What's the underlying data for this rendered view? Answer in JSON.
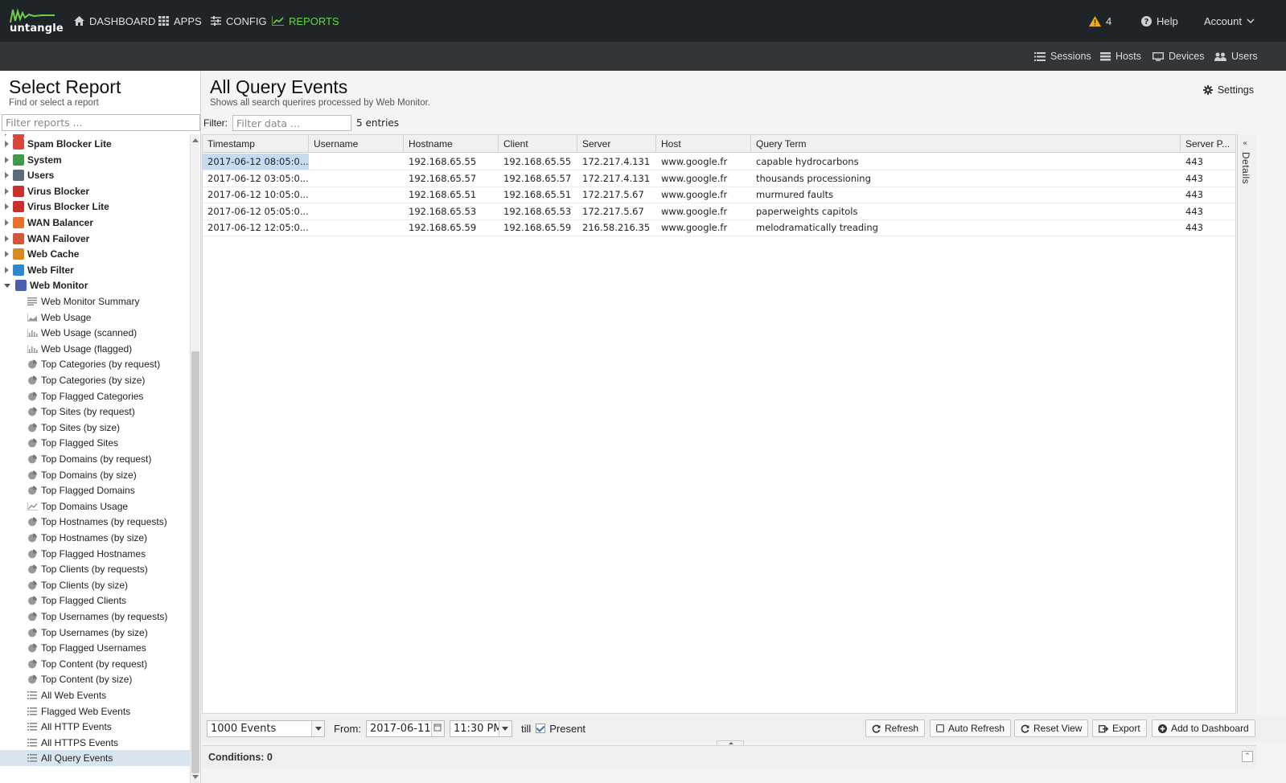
{
  "brand": {
    "name": "untangle",
    "accent": "#6cd14a"
  },
  "nav": {
    "dashboard": "DASHBOARD",
    "apps": "APPS",
    "config": "CONFIG",
    "reports": "REPORTS",
    "alerts_count": "4",
    "help": "Help",
    "account": "Account"
  },
  "subnav": {
    "sessions": "Sessions",
    "hosts": "Hosts",
    "devices": "Devices",
    "users": "Users"
  },
  "left": {
    "title": "Select Report",
    "subtitle": "Find or select a report",
    "search_placeholder": "Filter reports ...",
    "apps": [
      {
        "label": "Spam Blocker Lite",
        "color": "#d9463b"
      },
      {
        "label": "System",
        "color": "#3f9b4b"
      },
      {
        "label": "Users",
        "color": "#5b6b7c"
      },
      {
        "label": "Virus Blocker",
        "color": "#c9302c"
      },
      {
        "label": "Virus Blocker Lite",
        "color": "#c9302c"
      },
      {
        "label": "WAN Balancer",
        "color": "#e8702a"
      },
      {
        "label": "WAN Failover",
        "color": "#d4553a"
      },
      {
        "label": "Web Cache",
        "color": "#d88a1f"
      },
      {
        "label": "Web Filter",
        "color": "#2b8ad1"
      }
    ],
    "open_app": {
      "label": "Web Monitor",
      "color": "#4a5fb3"
    },
    "reports": [
      {
        "label": "Web Monitor Summary",
        "icon": "text-icon"
      },
      {
        "label": "Web Usage",
        "icon": "area-chart-icon"
      },
      {
        "label": "Web Usage (scanned)",
        "icon": "bar-chart-icon"
      },
      {
        "label": "Web Usage (flagged)",
        "icon": "bar-chart-icon"
      },
      {
        "label": "Top Categories (by request)",
        "icon": "pie-chart-icon"
      },
      {
        "label": "Top Categories (by size)",
        "icon": "pie-chart-icon"
      },
      {
        "label": "Top Flagged Categories",
        "icon": "pie-chart-icon"
      },
      {
        "label": "Top Sites (by request)",
        "icon": "pie-chart-icon"
      },
      {
        "label": "Top Sites (by size)",
        "icon": "pie-chart-icon"
      },
      {
        "label": "Top Flagged Sites",
        "icon": "pie-chart-icon"
      },
      {
        "label": "Top Domains (by request)",
        "icon": "pie-chart-icon"
      },
      {
        "label": "Top Domains (by size)",
        "icon": "pie-chart-icon"
      },
      {
        "label": "Top Flagged Domains",
        "icon": "pie-chart-icon"
      },
      {
        "label": "Top Domains Usage",
        "icon": "line-chart-icon"
      },
      {
        "label": "Top Hostnames (by requests)",
        "icon": "pie-chart-icon"
      },
      {
        "label": "Top Hostnames (by size)",
        "icon": "pie-chart-icon"
      },
      {
        "label": "Top Flagged Hostnames",
        "icon": "pie-chart-icon"
      },
      {
        "label": "Top Clients (by requests)",
        "icon": "pie-chart-icon"
      },
      {
        "label": "Top Clients (by size)",
        "icon": "pie-chart-icon"
      },
      {
        "label": "Top Flagged Clients",
        "icon": "pie-chart-icon"
      },
      {
        "label": "Top Usernames (by requests)",
        "icon": "pie-chart-icon"
      },
      {
        "label": "Top Usernames (by size)",
        "icon": "pie-chart-icon"
      },
      {
        "label": "Top Flagged Usernames",
        "icon": "pie-chart-icon"
      },
      {
        "label": "Top Content (by request)",
        "icon": "pie-chart-icon"
      },
      {
        "label": "Top Content (by size)",
        "icon": "pie-chart-icon"
      },
      {
        "label": "All Web Events",
        "icon": "list-icon"
      },
      {
        "label": "Flagged Web Events",
        "icon": "list-icon"
      },
      {
        "label": "All HTTP Events",
        "icon": "list-icon"
      },
      {
        "label": "All HTTPS Events",
        "icon": "list-icon"
      },
      {
        "label": "All Query Events",
        "icon": "list-icon",
        "selected": true
      }
    ]
  },
  "main": {
    "title": "All Query Events",
    "subtitle": "Shows all search querires processed by Web Monitor.",
    "settings": "Settings",
    "filter_label": "Filter:",
    "filter_placeholder": "Filter data ...",
    "entries": "5 entries",
    "columns": [
      "Timestamp",
      "Username",
      "Hostname",
      "Client",
      "Server",
      "Host",
      "Query Term",
      "Server P..."
    ],
    "rows": [
      [
        "2017-06-12 08:05:0...",
        "",
        "192.168.65.55",
        "192.168.65.55",
        "172.217.4.131",
        "www.google.fr",
        "capable hydrocarbons",
        "443"
      ],
      [
        "2017-06-12 03:05:0...",
        "",
        "192.168.65.57",
        "192.168.65.57",
        "172.217.4.131",
        "www.google.fr",
        "thousands processioning",
        "443"
      ],
      [
        "2017-06-12 10:05:0...",
        "",
        "192.168.65.51",
        "192.168.65.51",
        "172.217.5.67",
        "www.google.fr",
        "murmured faults",
        "443"
      ],
      [
        "2017-06-12 05:05:0...",
        "",
        "192.168.65.53",
        "192.168.65.53",
        "172.217.5.67",
        "www.google.fr",
        "paperweights capitols",
        "443"
      ],
      [
        "2017-06-12 12:05:0...",
        "",
        "192.168.65.59",
        "192.168.65.59",
        "216.58.216.35",
        "www.google.fr",
        "melodramatically treading",
        "443"
      ]
    ],
    "details_label": "Details",
    "events_select": "1000 Events",
    "from_label": "From:",
    "from_date": "2017-06-11",
    "from_time": "11:30 PM",
    "till_label": "till",
    "present_label": "Present",
    "present_checked": true,
    "buttons": {
      "refresh": "Refresh",
      "auto_refresh": "Auto Refresh",
      "reset_view": "Reset View",
      "export": "Export",
      "add_dashboard": "Add to Dashboard"
    },
    "conditions": "Conditions: 0"
  }
}
